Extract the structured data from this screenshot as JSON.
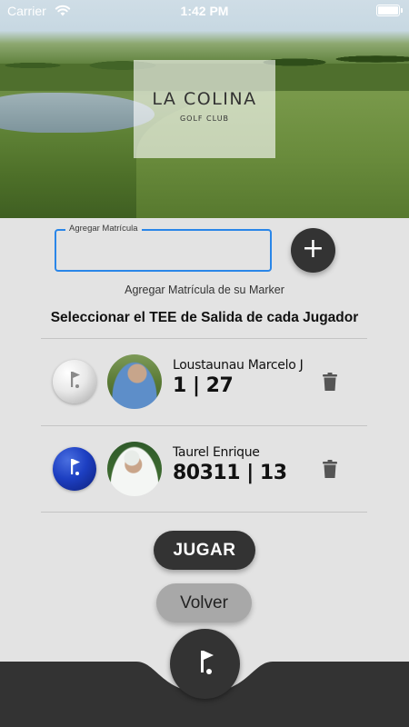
{
  "status_bar": {
    "carrier": "Carrier",
    "time": "1:42 PM"
  },
  "header": {
    "club_name": "LA COLINA",
    "club_subtitle": "GOLF CLUB"
  },
  "form": {
    "field_label": "Agregar Matrícula",
    "field_value": "",
    "add_icon": "+"
  },
  "hint": "Agregar Matrícula de su Marker",
  "section_title": "Seleccionar el TEE de Salida de cada Jugador",
  "players": [
    {
      "name": "Loustaunau Marcelo J",
      "numbers": "1 | 27",
      "tee_color": "#ffffff"
    },
    {
      "name": "Taurel Enrique",
      "numbers": "80311 | 13",
      "tee_color": "#1d3fc2"
    }
  ],
  "buttons": {
    "play": "JUGAR",
    "back": "Volver"
  },
  "colors": {
    "accent": "#2a86e8",
    "dark": "#333333",
    "background": "#e3e3e3"
  },
  "icons": [
    "wifi-icon",
    "battery-icon",
    "plus-icon",
    "golf-flag-icon",
    "trash-icon"
  ]
}
